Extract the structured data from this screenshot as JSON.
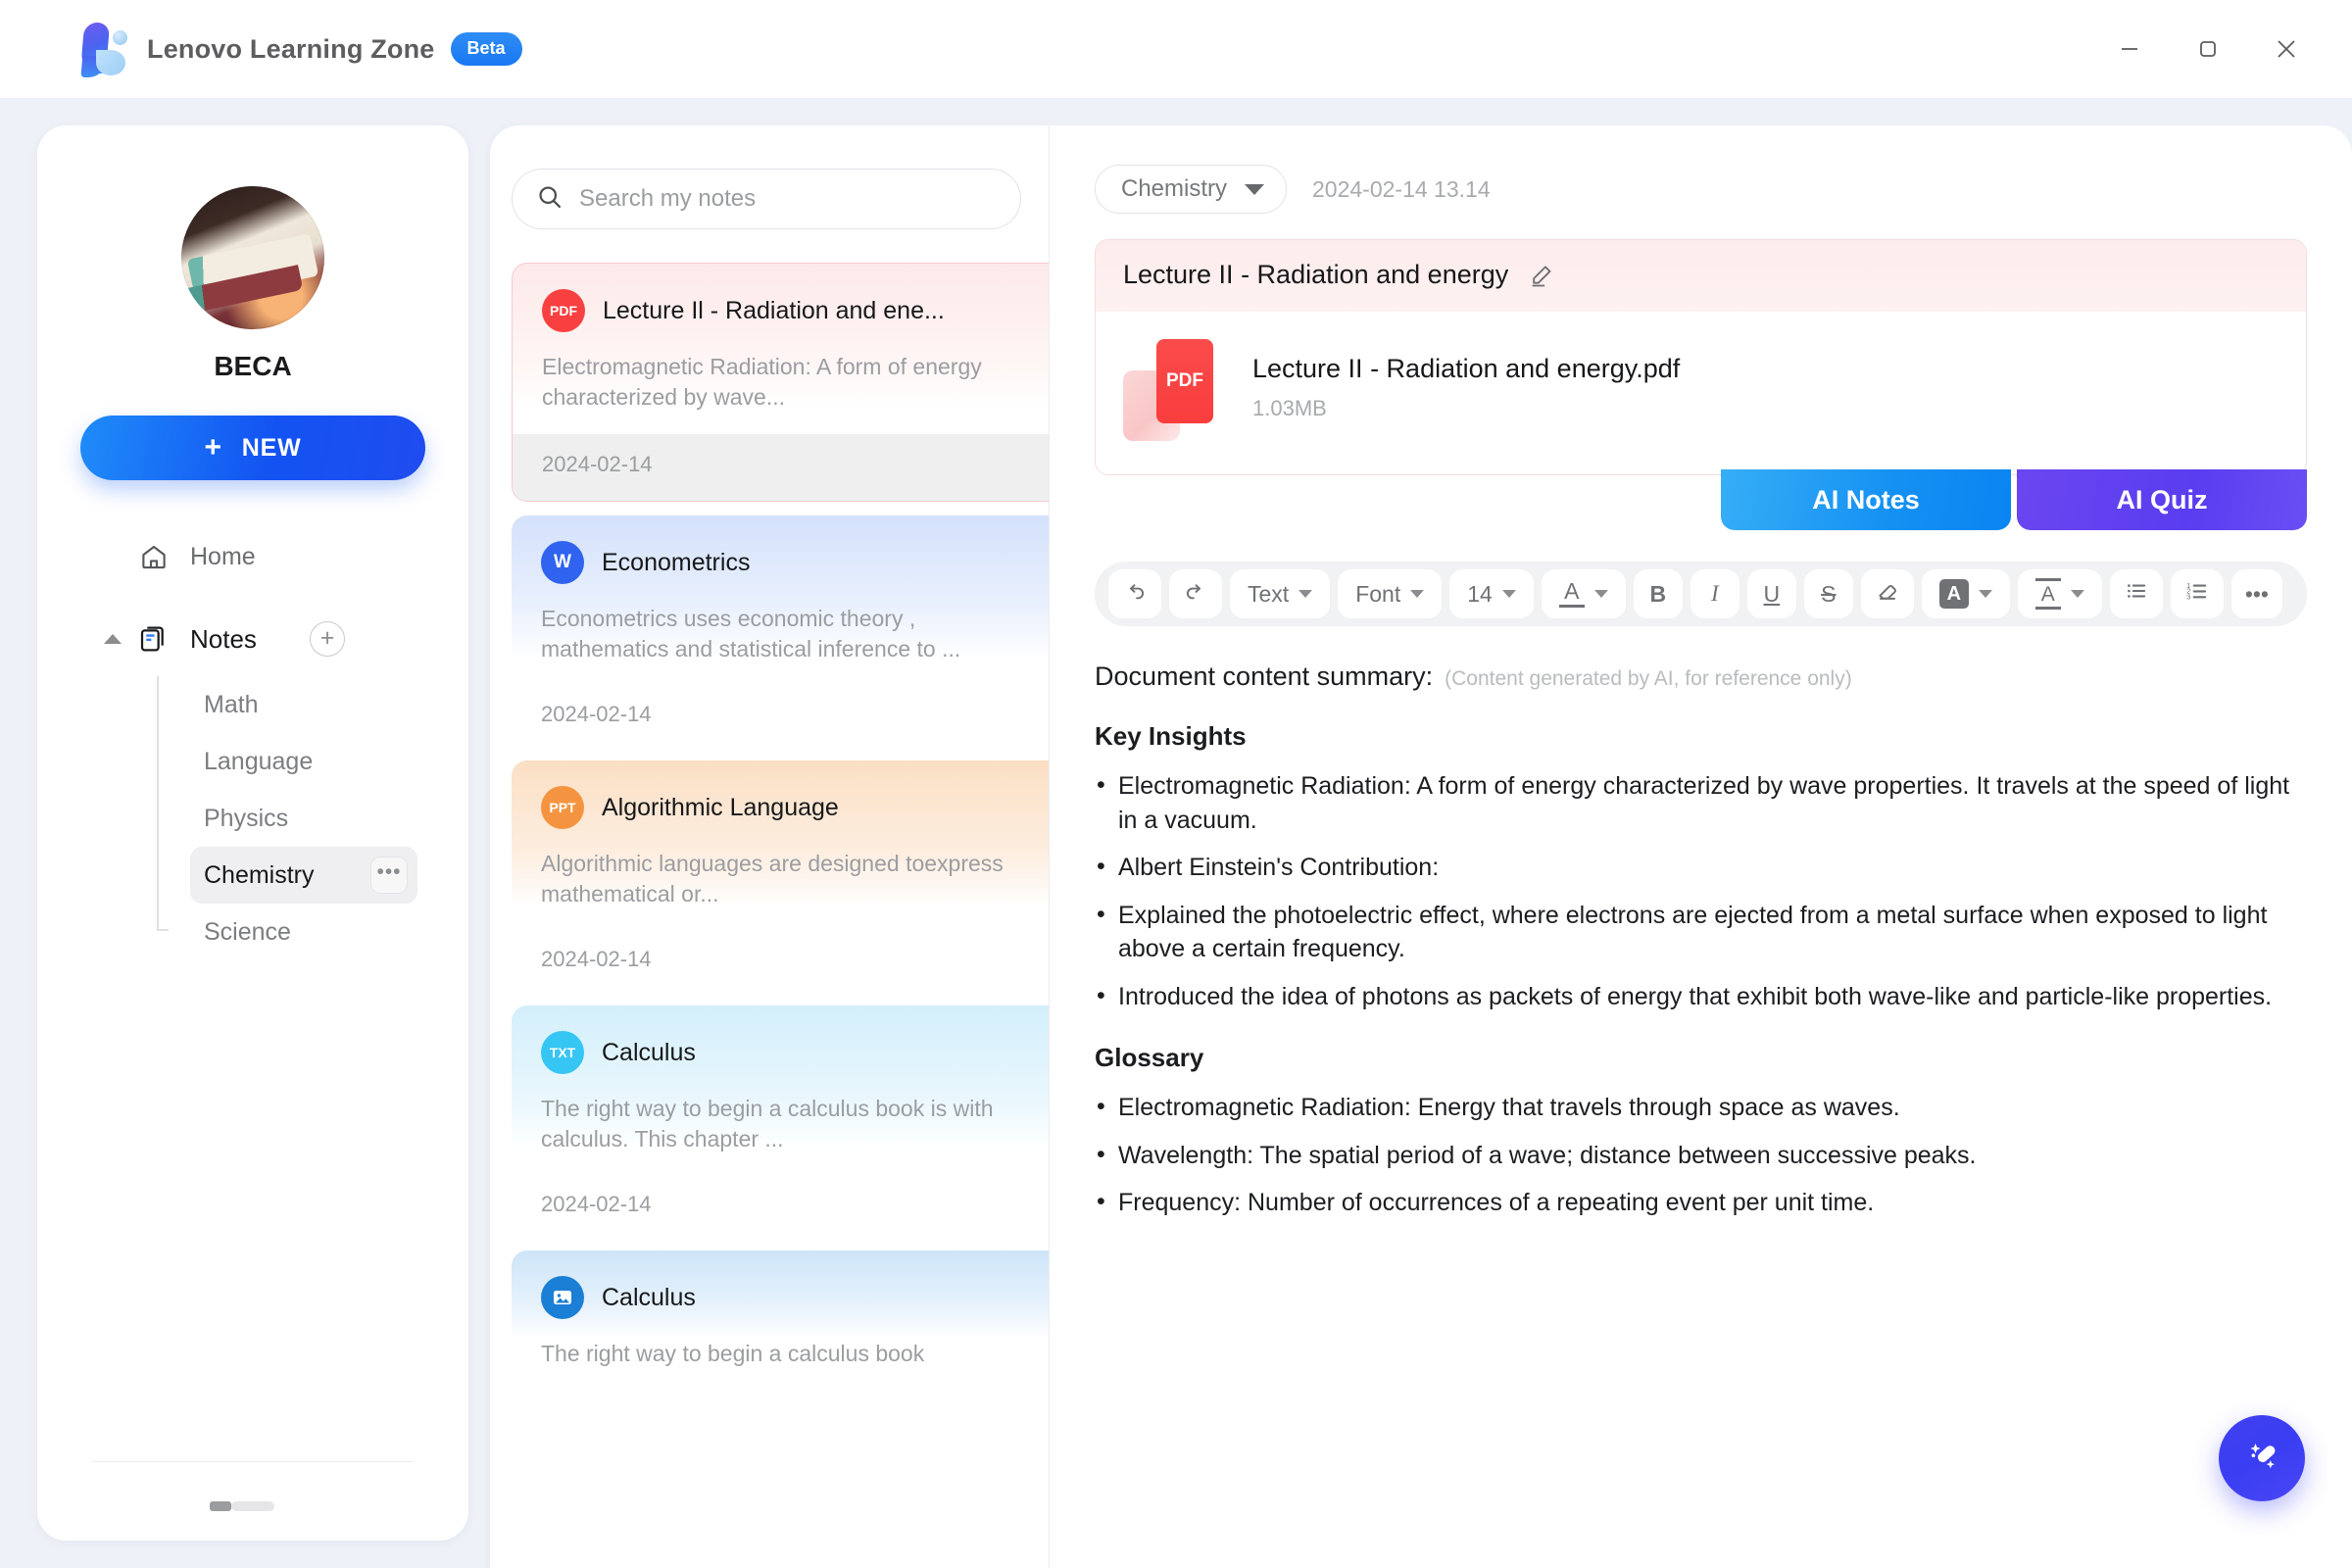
{
  "titlebar": {
    "app_title": "Lenovo Learning Zone",
    "badge": "Beta",
    "minimize_icon": "minimize-icon",
    "maximize_icon": "maximize-icon",
    "close_icon": "close-icon"
  },
  "sidebar": {
    "username": "BECA",
    "new_button": "NEW",
    "new_plus": "+",
    "nav": [
      {
        "label": "Home",
        "icon": "home-icon"
      },
      {
        "label": "Notes",
        "icon": "notes-icon"
      }
    ],
    "subitems": [
      {
        "label": "Math",
        "active": false
      },
      {
        "label": "Language",
        "active": false
      },
      {
        "label": "Physics",
        "active": false
      },
      {
        "label": "Chemistry",
        "active": true
      },
      {
        "label": "Science",
        "active": false
      }
    ],
    "more_dots": "•••"
  },
  "notes_panel": {
    "search_placeholder": "Search my notes",
    "search_value": "",
    "cards": [
      {
        "badge": "PDF",
        "title": "Lecture Il - Radiation and ene...",
        "snippet": "Electromagnetic Radiation: A form of energy characterized by wave...",
        "date": "2024-02-14",
        "selected": true
      },
      {
        "badge": "W",
        "title": "Econometrics",
        "snippet": "Econometrics uses economic theory , mathematics  and statistical inference to ...",
        "date": "2024-02-14",
        "selected": false
      },
      {
        "badge": "PPT",
        "title": "Algorithmic Language",
        "snippet": "Algorithmic languages are designed toexpress mathematical or...",
        "date": "2024-02-14",
        "selected": false
      },
      {
        "badge": "TXT",
        "title": "Calculus",
        "snippet": "The right way to begin a calculus book is with calculus. This chapter ...",
        "date": "2024-02-14",
        "selected": false
      },
      {
        "badge": "IMG",
        "title": "Calculus",
        "snippet": "The right way to begin a calculus book",
        "date": "",
        "selected": false
      }
    ]
  },
  "detail": {
    "category_chip": "Chemistry",
    "timestamp": "2024-02-14 13.14",
    "doc_title": "Lecture II - Radiation and energy",
    "edit_icon": "pencil-icon",
    "file_badge": "PDF",
    "file_name": "Lecture II - Radiation and energy.pdf",
    "file_size": "1.03MB",
    "ai_notes_button": "AI Notes",
    "ai_quiz_button": "AI Quiz",
    "toolbar": {
      "undo": "undo-icon",
      "redo": "redo-icon",
      "text_style": "Text",
      "font": "Font",
      "font_size": "14",
      "font_color": "A",
      "bold": "B",
      "italic": "I",
      "underline": "U",
      "strikethrough": "S",
      "clear_format": "eraser-icon",
      "highlight": "A",
      "text_color": "A",
      "bullet_list": "bullet-list-icon",
      "numbered_list": "numbered-list-icon",
      "more": "•••"
    },
    "summary_title": "Document content summary:",
    "summary_note": "(Content generated by AI, for reference only)",
    "sections": [
      {
        "heading": "Key Insights",
        "bullets": [
          "Electromagnetic Radiation: A form of energy characterized by wave properties. It travels at the speed of light in a vacuum.",
          "Albert Einstein's Contribution:",
          "Explained the photoelectric effect, where electrons are ejected from a metal surface when exposed to light above a certain frequency.",
          "Introduced the idea of photons as packets of energy that exhibit both wave-like and particle-like properties."
        ]
      },
      {
        "heading": "Glossary",
        "bullets": [
          "Electromagnetic Radiation: Energy that travels through space as waves.",
          "Wavelength: The spatial period of a wave; distance between successive peaks.",
          "Frequency: Number of occurrences of a repeating event per unit time."
        ]
      }
    ],
    "fab_icon": "magic-wand-icon"
  },
  "colors": {
    "accent_blue": "#1353f2",
    "ai_notes": "#1490f3",
    "ai_quiz": "#5a3df0",
    "pdf_red": "#fb4b4b",
    "word_blue": "#2f63f0",
    "ppt_orange": "#f59440",
    "txt_cyan": "#36c6f4",
    "img_blue": "#1c7fd6",
    "fab": "#3a3ef2"
  }
}
